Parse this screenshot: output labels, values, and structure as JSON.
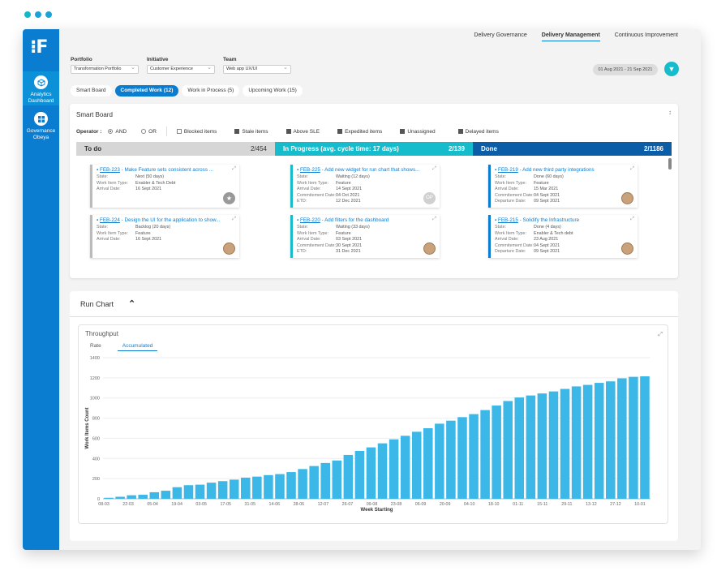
{
  "nav": {
    "items": [
      {
        "label_line1": "Analytics",
        "label_line2": "Dashboard"
      },
      {
        "label_line1": "Governance",
        "label_line2": "Obeya"
      }
    ]
  },
  "topnav": {
    "items": [
      "Delivery Governance",
      "Delivery Management",
      "Continuous Improvement"
    ],
    "active": "Delivery Management"
  },
  "filters": {
    "portfolio": {
      "label": "Portfolio",
      "value": "Transformation Portfolio"
    },
    "initiative": {
      "label": "Initiative",
      "value": "Customer Experience"
    },
    "team": {
      "label": "Team",
      "value": "Web app UX/UI"
    }
  },
  "date_range": "01 Aug 2021 - 21 Sep 2021",
  "tabs": [
    "Smart Board",
    "Completed Work (12)",
    "Work in Process (5)",
    "Upcoming Work (15)"
  ],
  "smart_board": {
    "title": "Smart Board",
    "operator_label": "Operator :",
    "operator_and": "AND",
    "operator_or": "OR",
    "checks": [
      "Blocked items",
      "Stale items",
      "Above SLE",
      "Expedited items",
      "Unassigned",
      "Delayed items"
    ],
    "columns": [
      {
        "title": "To do",
        "count": "2/454",
        "color": "#d6d6d6"
      },
      {
        "title": "In Progress (avg. cycle time: 17 days)",
        "count": "2/139",
        "color": "#17bccc"
      },
      {
        "title": "Done",
        "count": "2/1186",
        "color": "#0b5da8"
      }
    ],
    "todo_cards": [
      {
        "id": "FEB-223",
        "title": " - Make Feature sets consistent across ...",
        "rows": [
          [
            "State:",
            "Next (50 days)"
          ],
          [
            "Work Item Type:",
            "Enabler & Tech Debt"
          ],
          [
            "Arrival Date:",
            "16 Sept 2021"
          ]
        ]
      },
      {
        "id": "FEB-224",
        "title": " - Design the UI for the application to show...",
        "rows": [
          [
            "State:",
            "Backlog (20 days)"
          ],
          [
            "Work Item Type:",
            "Feature"
          ],
          [
            "Arrival Date:",
            "16 Sept 2021"
          ]
        ]
      }
    ],
    "progress_cards": [
      {
        "id": "FEB-225",
        "title": " - Add new widget for run chart that shows...",
        "rows": [
          [
            "State:",
            "Waiting (12 days)"
          ],
          [
            "Work Item Type:",
            "Feature"
          ],
          [
            "Arrival Date:",
            "14 Sept 2021"
          ],
          [
            "Commitement Date:",
            "04 Oct 2021"
          ],
          [
            "ETD:",
            "12 Dec 2021"
          ]
        ],
        "avatar": "OP"
      },
      {
        "id": "FEB-220",
        "title": " - Add filters for the dashboard",
        "rows": [
          [
            "State:",
            "Waiting (33 days)"
          ],
          [
            "Work Item Type:",
            "Feature"
          ],
          [
            "Arrival Date:",
            "03 Sept 2021"
          ],
          [
            "Commitement Date:",
            "30 Sept 2021"
          ],
          [
            "ETD:",
            "31 Dec 2021"
          ]
        ]
      }
    ],
    "done_cards": [
      {
        "id": "FEB-219",
        "title": " - Add new third party integrations",
        "rows": [
          [
            "State:",
            "Done (60 days)"
          ],
          [
            "Work Item Type:",
            "Feature"
          ],
          [
            "Arrival Date:",
            "15 Mar 2021"
          ],
          [
            "Commitement Date:",
            "04 Sept 2021"
          ],
          [
            "Departure Date:",
            "09 Sept 2021"
          ]
        ]
      },
      {
        "id": "FEB-215",
        "title": " - Solidify the Infrastructure",
        "rows": [
          [
            "State:",
            "Done (4 days)"
          ],
          [
            "Work Item Type:",
            "Enabler & Tech debt"
          ],
          [
            "Arrival Date:",
            "23 Aug 2021"
          ],
          [
            "Commitement Date:",
            "04 Sept 2021"
          ],
          [
            "Departure Date:",
            "09 Sept 2021"
          ]
        ]
      }
    ]
  },
  "run_chart": {
    "header": "Run Chart",
    "title": "Throughput",
    "tabs": [
      "Rate",
      "Accumulated"
    ],
    "active_tab": "Accumulated"
  },
  "chart_data": {
    "type": "bar",
    "xlabel": "Week Starting",
    "ylabel": "Work Items Count",
    "ylim": [
      0,
      1400
    ],
    "yticks": [
      0,
      200,
      400,
      600,
      800,
      1000,
      1200,
      1400
    ],
    "xtick_labels": [
      "08-03",
      "22-03",
      "05-04",
      "19-04",
      "03-05",
      "17-05",
      "31-05",
      "14-06",
      "28-06",
      "12-07",
      "26-07",
      "09-08",
      "23-08",
      "06-09",
      "20-09",
      "04-10",
      "18-10",
      "01-11",
      "15-11",
      "29-11",
      "13-12",
      "27-12",
      "10-01"
    ],
    "values": [
      10,
      20,
      35,
      40,
      65,
      80,
      115,
      135,
      140,
      160,
      175,
      190,
      210,
      220,
      235,
      245,
      265,
      295,
      325,
      355,
      380,
      435,
      475,
      510,
      550,
      590,
      625,
      665,
      700,
      745,
      775,
      810,
      840,
      880,
      925,
      970,
      1005,
      1025,
      1045,
      1065,
      1090,
      1115,
      1130,
      1150,
      1165,
      1195,
      1210,
      1215
    ],
    "grid": true,
    "legend": "none"
  },
  "colors": {
    "accent": "#0b7dd1",
    "teal": "#17bccc",
    "bar": "#3bb8e8"
  }
}
